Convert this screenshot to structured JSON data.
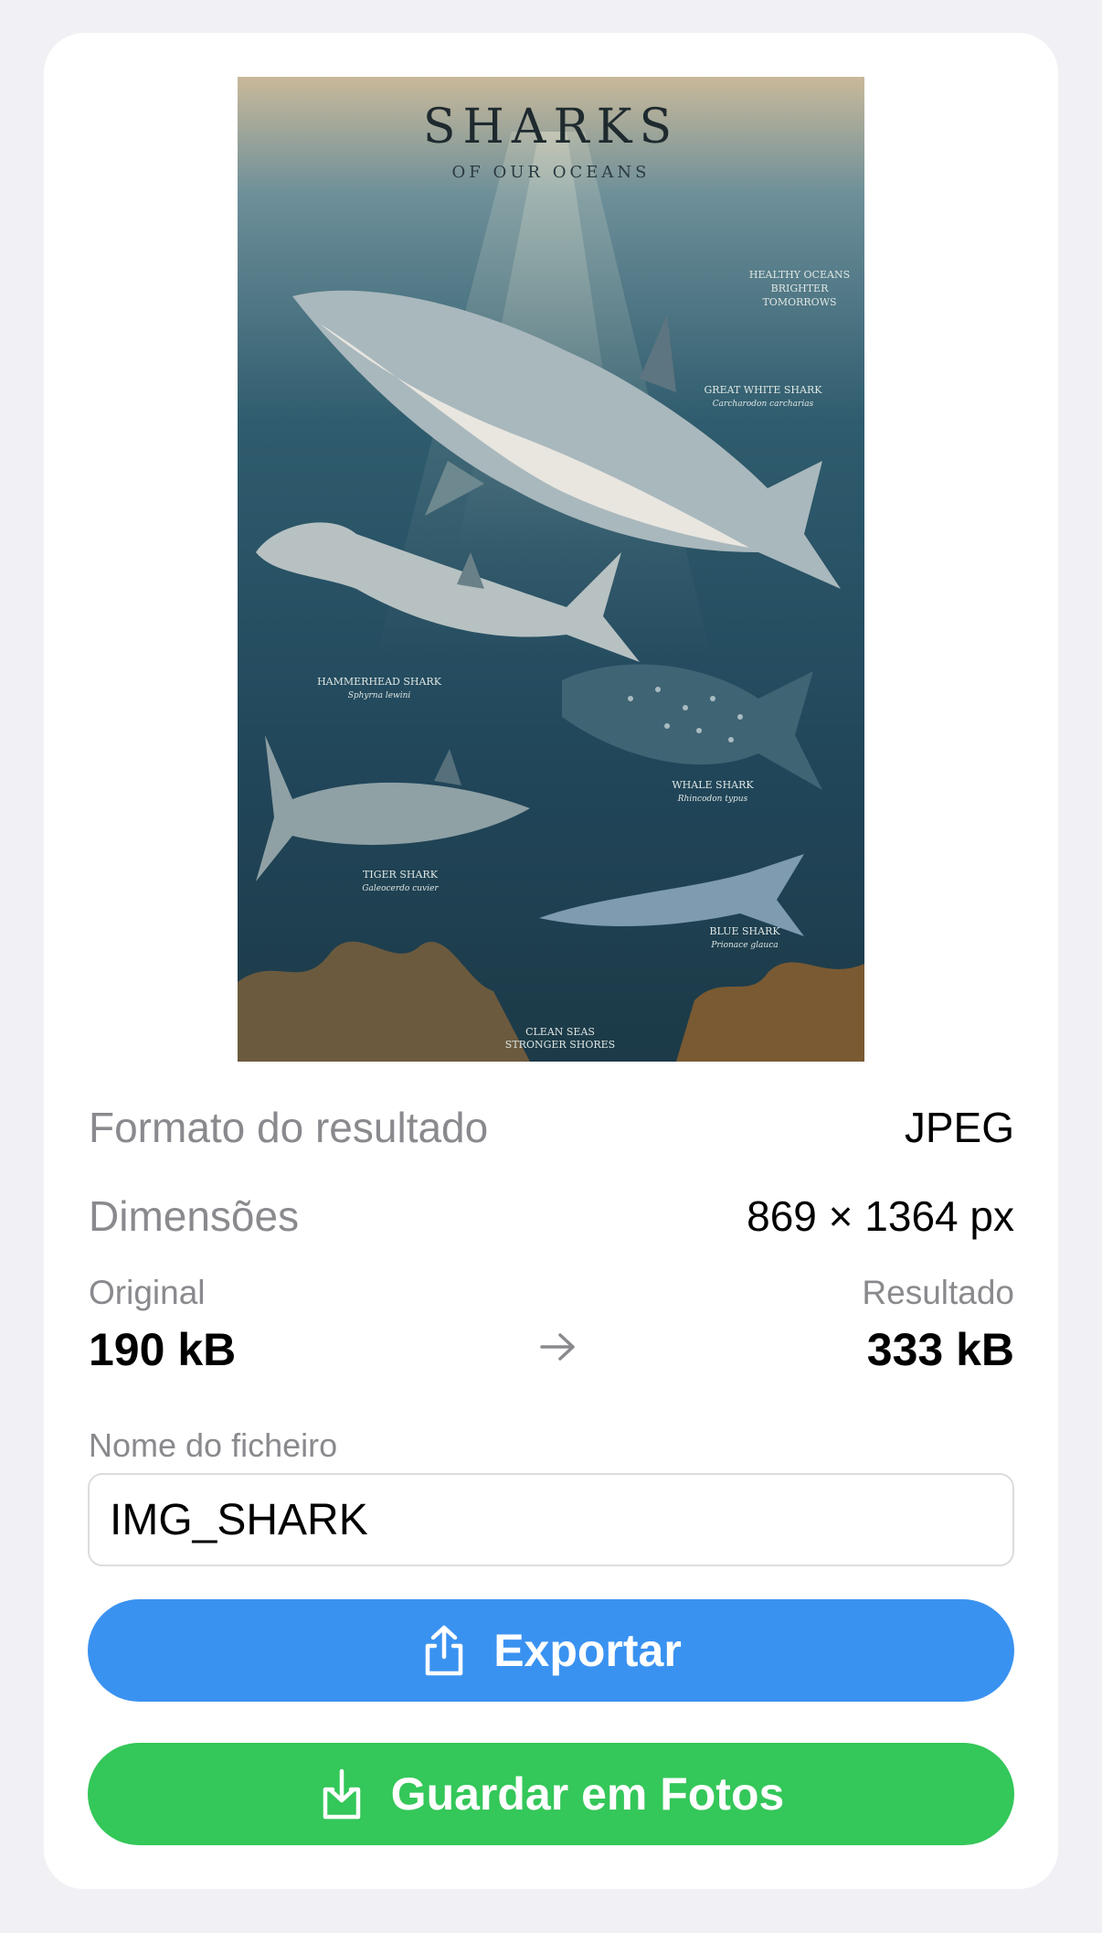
{
  "preview": {
    "title": "SHARKS",
    "subtitle": "OF OUR OCEANS",
    "tagline_top": [
      "HEALTHY OCEANS",
      "BRIGHTER",
      "TOMORROWS"
    ],
    "species": [
      {
        "name": "GREAT WHITE SHARK",
        "latin": "Carcharodon carcharias"
      },
      {
        "name": "HAMMERHEAD SHARK",
        "latin": "Sphyrna lewini"
      },
      {
        "name": "WHALE SHARK",
        "latin": "Rhincodon typus"
      },
      {
        "name": "TIGER SHARK",
        "latin": "Galeocerdo cuvier"
      },
      {
        "name": "BLUE SHARK",
        "latin": "Prionace glauca"
      }
    ],
    "tagline_bottom": [
      "CLEAN SEAS",
      "STRONGER SHORES"
    ]
  },
  "info": {
    "format_label": "Formato do resultado",
    "format_value": "JPEG",
    "dimensions_label": "Dimensões",
    "dimensions_value": "869 × 1364 px"
  },
  "sizes": {
    "original_label": "Original",
    "original_value": "190 kB",
    "result_label": "Resultado",
    "result_value": "333 kB"
  },
  "filename": {
    "label": "Nome do ficheiro",
    "value": "IMG_SHARK"
  },
  "buttons": {
    "export_label": "Exportar",
    "save_label": "Guardar em Fotos"
  },
  "colors": {
    "export": "#3a92f0",
    "save": "#34c759",
    "background": "#f1f1f5"
  },
  "icons": {
    "export": "share-icon",
    "save": "download-to-device-icon",
    "arrow": "arrow-right-icon"
  }
}
